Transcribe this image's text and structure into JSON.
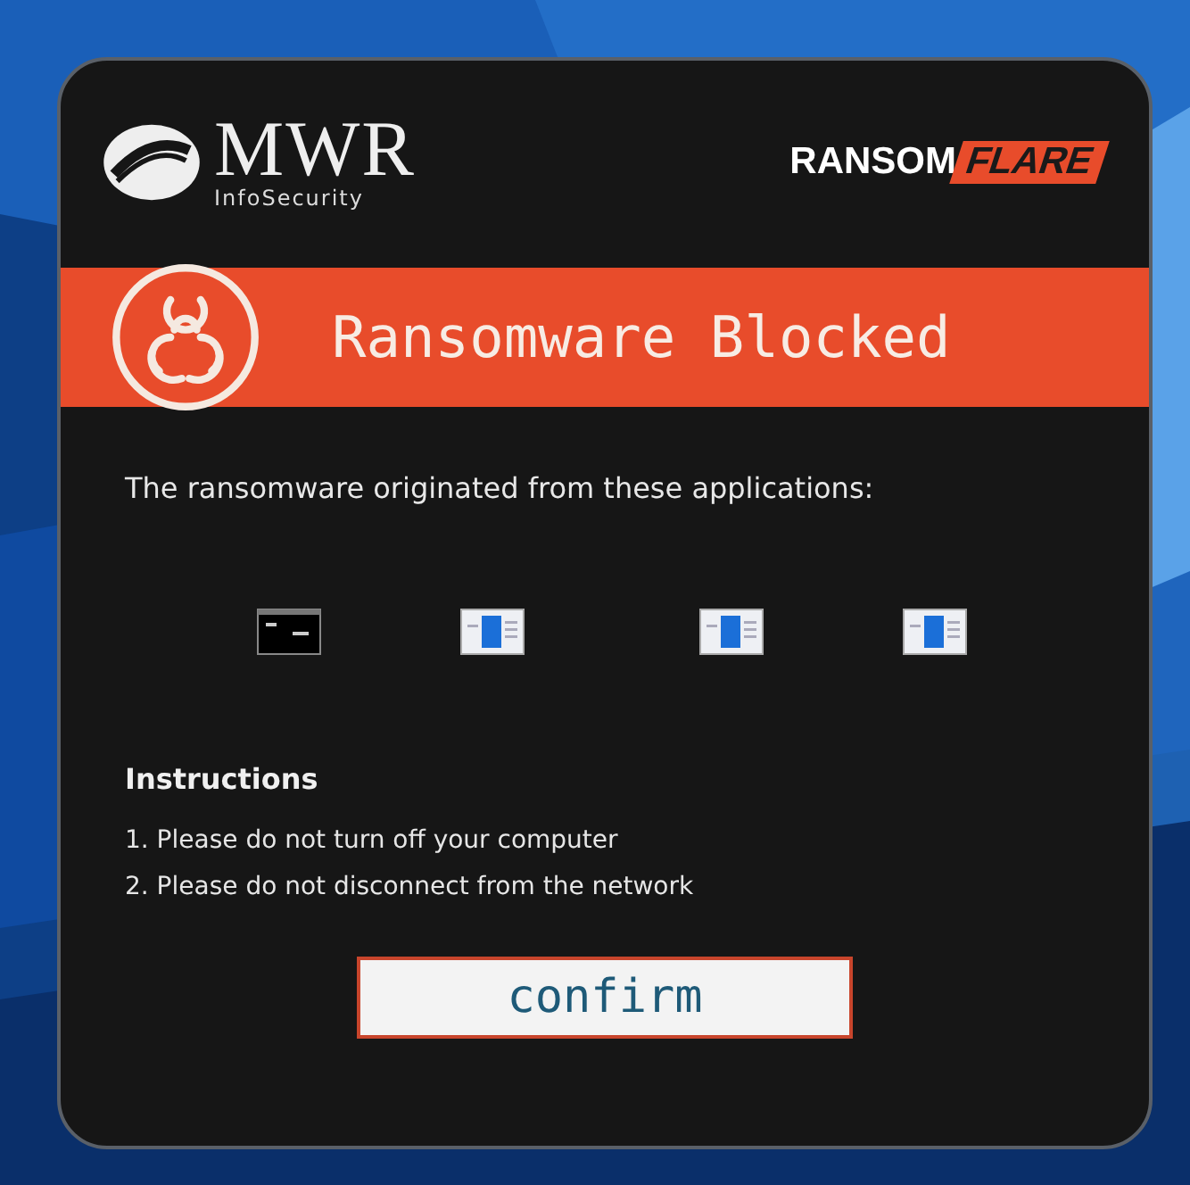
{
  "vendor_logo": {
    "name": "MWR",
    "subtitle": "InfoSecurity"
  },
  "product_logo": {
    "part_1": "RANSOM",
    "part_2": "FLARE"
  },
  "banner": {
    "title": "Ransomware Blocked"
  },
  "message": "The ransomware originated from these applications:",
  "applications": [
    {
      "kind": "console"
    },
    {
      "kind": "window"
    },
    {
      "kind": "window"
    },
    {
      "kind": "window"
    }
  ],
  "instructions": {
    "heading": "Instructions",
    "items": [
      "1. Please do not turn off your computer",
      "2. Please do not disconnect from the network"
    ]
  },
  "button": "confirm"
}
